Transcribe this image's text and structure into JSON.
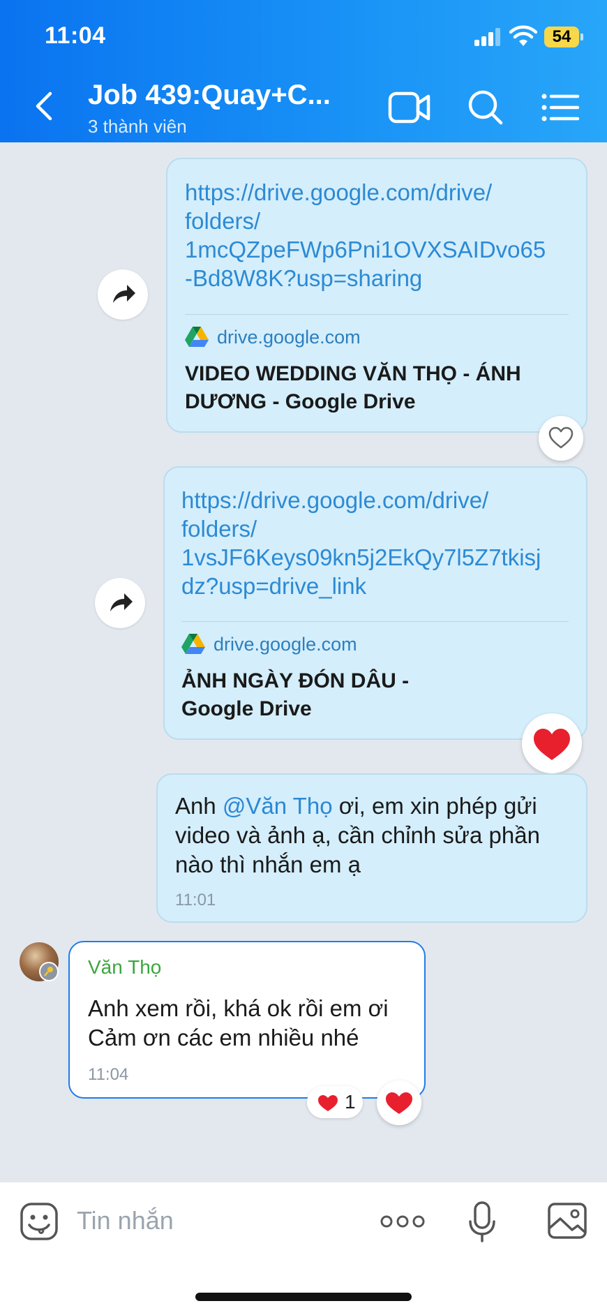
{
  "status_bar": {
    "time": "11:04",
    "battery": "54"
  },
  "header": {
    "title": "Job 439:Quay+C...",
    "subtitle": "3 thành viên"
  },
  "messages": [
    {
      "link": "https://drive.google.com/drive/folders/1mcQZpeFWp6Pni1OVXSAIDvo65-Bd8W8K?usp=sharing",
      "link_lines": [
        "https://drive.google.com/drive/",
        "folders/",
        "1mcQZpeFWp6Pni1OVXSAIDvo65",
        "-Bd8W8K?usp=sharing"
      ],
      "domain": "drive.google.com",
      "title_lines": [
        "VIDEO WEDDING VĂN THỌ - ÁNH",
        "DƯƠNG - Google Drive"
      ]
    },
    {
      "link": "https://drive.google.com/drive/folders/1vsJF6Keys09kn5j2EkQy7l5Z7tkisjdz?usp=drive_link",
      "link_lines": [
        "https://drive.google.com/drive/",
        "folders/",
        "1vsJF6Keys09kn5j2EkQy7l5Z7tkisj",
        "dz?usp=drive_link"
      ],
      "domain": "drive.google.com",
      "title_lines": [
        "ẢNH NGÀY ĐÓN DÂU -",
        "Google Drive"
      ]
    },
    {
      "prefix": "Anh ",
      "mention": "@Văn Thọ",
      "lines": [
        " ơi, em xin phép gửi",
        "video và ảnh ạ, cần chỉnh sửa phần",
        "nào thì nhắn em ạ"
      ],
      "time": "11:01"
    },
    {
      "sender": "Văn Thọ",
      "lines": [
        "Anh xem rồi, khá ok rồi em ơi",
        "Cảm ơn các em nhiều nhé"
      ],
      "time": "11:04",
      "reaction_count": "1"
    }
  ],
  "input": {
    "placeholder": "Tin nhắn"
  },
  "colors": {
    "header": "#0a73f0",
    "outgoing_bubble": "#d4eefb",
    "link": "#2c8ad4",
    "sender": "#3ca63f",
    "heart": "#e8202e"
  }
}
